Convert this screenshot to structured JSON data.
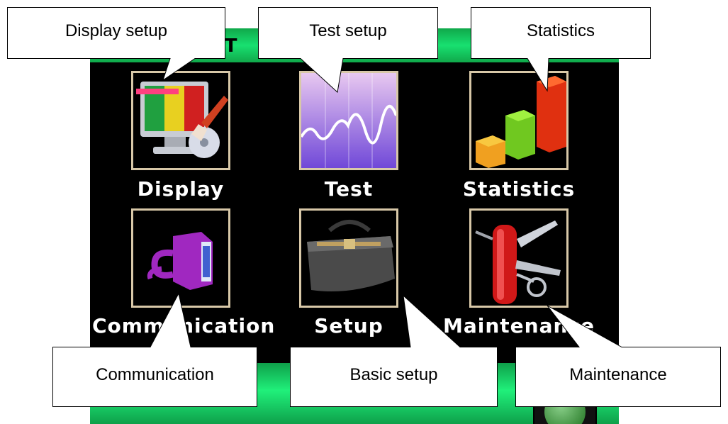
{
  "window": {
    "title": "ST"
  },
  "menu": {
    "items": [
      {
        "label": "Display",
        "icon": "display-icon"
      },
      {
        "label": "Test",
        "icon": "test-waveform-icon"
      },
      {
        "label": "Statistics",
        "icon": "statistics-chart-icon"
      },
      {
        "label": "Communication",
        "icon": "serial-connector-icon"
      },
      {
        "label": "Setup",
        "icon": "tool-bag-icon"
      },
      {
        "label": "Maintenance",
        "icon": "multitool-icon"
      }
    ]
  },
  "callouts": {
    "display": "Display setup",
    "test": "Test setup",
    "statistics": "Statistics",
    "communication": "Communication",
    "setup": "Basic setup",
    "maintenance": "Maintenance"
  },
  "colors": {
    "bar": "#18e070",
    "tile_border": "#d8c8a8",
    "screen": "#000000"
  }
}
